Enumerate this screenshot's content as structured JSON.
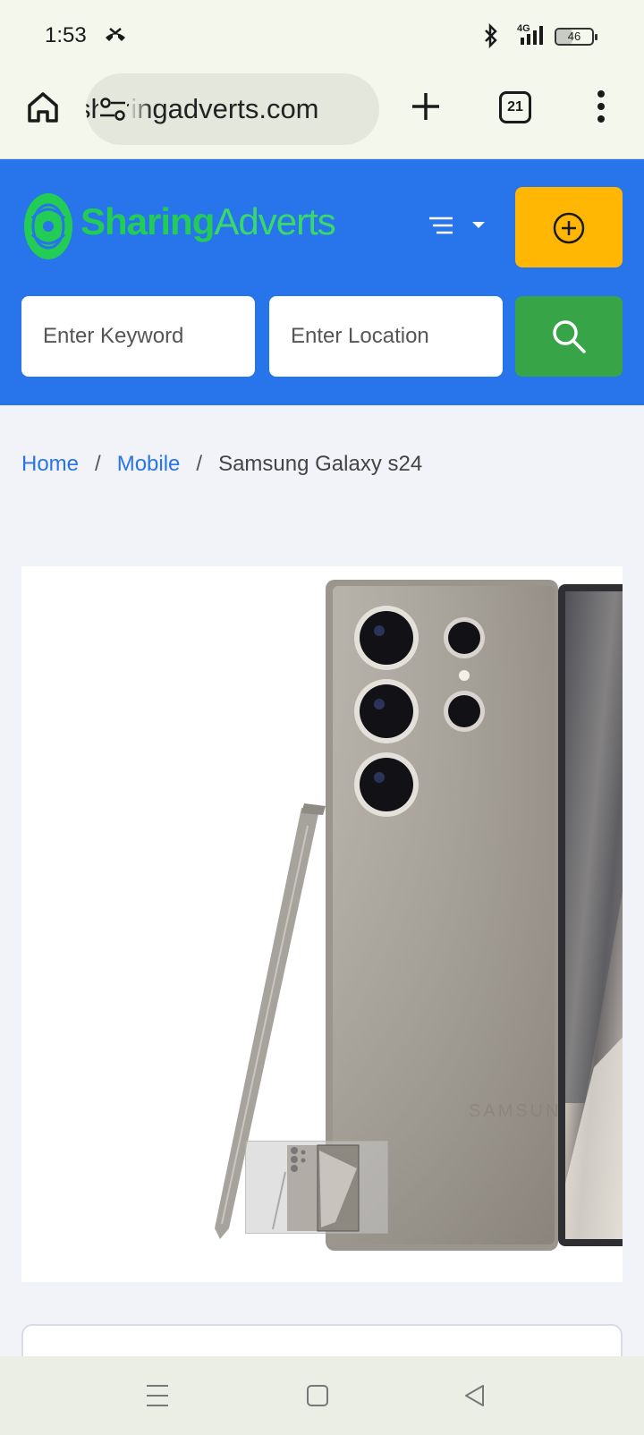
{
  "status_bar": {
    "time": "1:53",
    "network": "4G",
    "battery": "46",
    "battery_level": 0.46
  },
  "browser": {
    "url": "sharingadverts.com",
    "tab_count": "21",
    "icons": [
      "home-icon",
      "site-settings-icon",
      "new-tab-icon",
      "tabs-icon",
      "more-vert-icon"
    ]
  },
  "header": {
    "logo_bold": "Sharing",
    "logo_light": "Adverts",
    "keyword_placeholder": "Enter Keyword",
    "location_placeholder": "Enter Location",
    "colors": {
      "header_bg": "#2874eb",
      "logo": "#22cc55",
      "add_button": "#ffb703",
      "search_button": "#37a447"
    }
  },
  "breadcrumb": {
    "home": "Home",
    "category": "Mobile",
    "current": "Samsung Galaxy s24",
    "separator": "/"
  },
  "product": {
    "image_subject": "samsung-galaxy-s24-ultra-with-s-pen"
  },
  "system_nav": {
    "icons": [
      "recents-icon",
      "home-icon",
      "back-icon"
    ]
  }
}
